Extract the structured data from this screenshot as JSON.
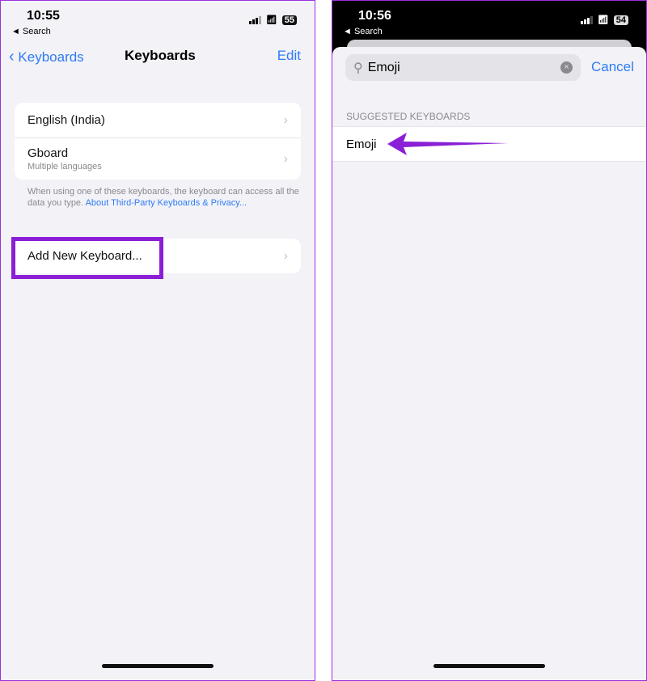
{
  "left": {
    "time": "10:55",
    "back": "◄ Search",
    "battery": "55",
    "nav": {
      "back_label": "Keyboards",
      "title": "Keyboards",
      "edit": "Edit"
    },
    "keyboards": [
      {
        "label": "English (India)"
      },
      {
        "label": "Gboard",
        "sub": "Multiple languages"
      }
    ],
    "footnote": "When using one of these keyboards, the keyboard can access all the data you type.",
    "footnote_link": "About Third-Party Keyboards & Privacy...",
    "add_keyboard": "Add New Keyboard...",
    "highlight_color": "#8a1fd6"
  },
  "right": {
    "time": "10:56",
    "back": "◄ Search",
    "battery": "54",
    "search_value": "Emoji",
    "cancel": "Cancel",
    "section_header": "SUGGESTED KEYBOARDS",
    "suggestion": "Emoji",
    "arrow_color": "#8a1fd6"
  }
}
